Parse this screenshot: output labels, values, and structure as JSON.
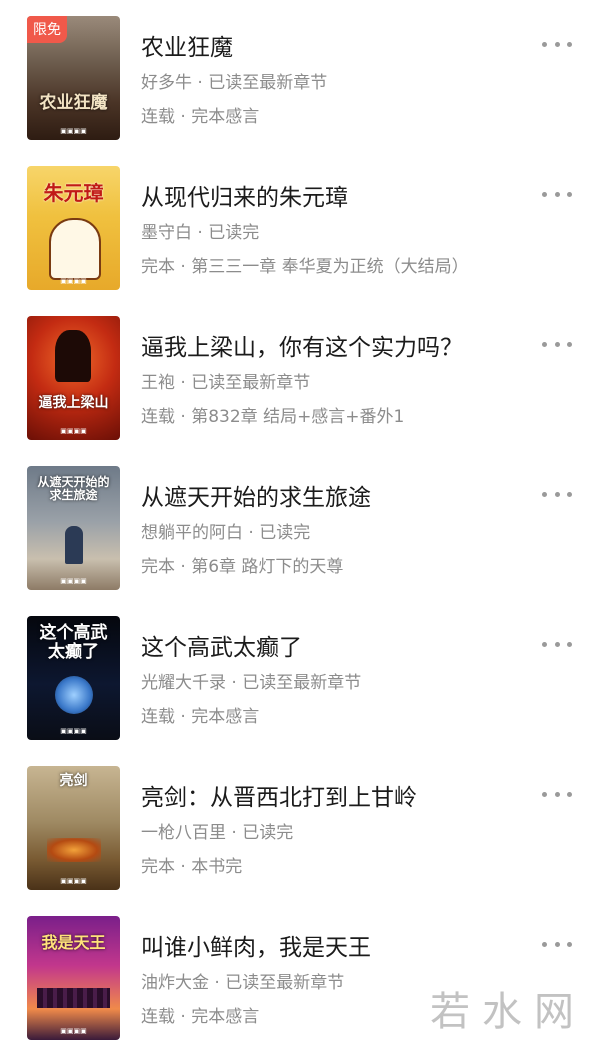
{
  "books": [
    {
      "title": "农业狂魔",
      "author_line": "好多牛 · 已读至最新章节",
      "status_line": "连载 · 完本感言",
      "badge": "限免",
      "cover_text": "农业狂魔"
    },
    {
      "title": "从现代归来的朱元璋",
      "author_line": "墨守白 · 已读完",
      "status_line": "完本 · 第三三一章 奉华夏为正统（大结局）",
      "cover_text": "朱元璋"
    },
    {
      "title": "逼我上梁山，你有这个实力吗？",
      "author_line": "王袍 · 已读至最新章节",
      "status_line": "连载 · 第832章 结局+感言+番外1",
      "cover_text": "逼我上梁山"
    },
    {
      "title": "从遮天开始的求生旅途",
      "author_line": "想躺平的阿白 · 已读完",
      "status_line": "完本 · 第6章 路灯下的天尊",
      "cover_text": "从遮天开始的求生旅途"
    },
    {
      "title": "这个高武太癫了",
      "author_line": "光耀大千录 · 已读至最新章节",
      "status_line": "连载 · 完本感言",
      "cover_text": "这个高武太癫了"
    },
    {
      "title": "亮剑：从晋西北打到上甘岭",
      "author_line": "一枪八百里 · 已读完",
      "status_line": "完本 · 本书完",
      "cover_text": "亮剑"
    },
    {
      "title": "叫谁小鲜肉，我是天王",
      "author_line": "油炸大金 · 已读至最新章节",
      "status_line": "连载 · 完本感言",
      "cover_text": "我是天王"
    }
  ],
  "watermark": "若水网",
  "colors": {
    "title": "#1b1b1b",
    "meta": "#8c8c8c",
    "badge": "#f0594a"
  }
}
